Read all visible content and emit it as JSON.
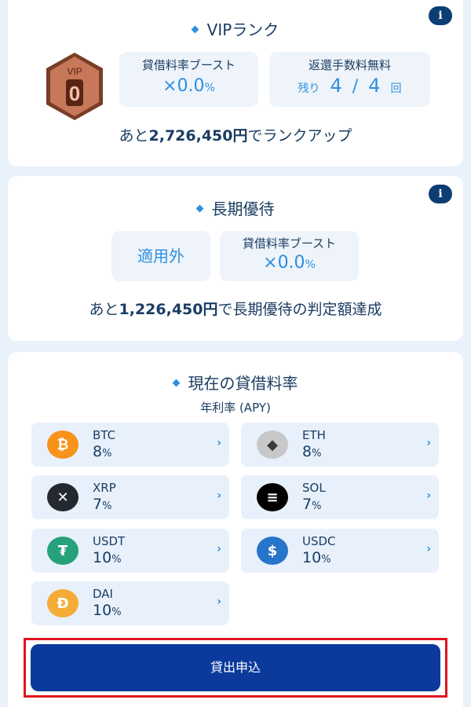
{
  "vip": {
    "title": "VIPランク",
    "badge_label": "VIP",
    "badge_level": "0",
    "boost_label": "貸借料率ブースト",
    "boost_prefix": "×",
    "boost_value": "0.0",
    "boost_unit": "%",
    "fee_label": "返還手数料無料",
    "fee_remaining_prefix": "残り",
    "fee_remaining": "4",
    "fee_separator": "/",
    "fee_total": "4",
    "fee_unit": "回",
    "rankup_prefix": "あと",
    "rankup_amount": "2,726,450円",
    "rankup_suffix": "でランクアップ"
  },
  "long_term": {
    "title": "長期優待",
    "status": "適用外",
    "boost_label": "貸借料率ブースト",
    "boost_prefix": "×",
    "boost_value": "0.0",
    "boost_unit": "%",
    "summary_prefix": "あと",
    "summary_amount": "1,226,450円",
    "summary_suffix": "で長期優待の判定額達成"
  },
  "rates": {
    "title": "現在の貸借料率",
    "subtitle": "年利率 (APY)",
    "coins": [
      {
        "name": "BTC",
        "rate": "8",
        "unit": "%",
        "icon": "btc-icon",
        "color": "#f7931a",
        "glyph": "₿"
      },
      {
        "name": "ETH",
        "rate": "8",
        "unit": "%",
        "icon": "eth-icon",
        "color": "#c8c8c8",
        "glyph": "◆"
      },
      {
        "name": "XRP",
        "rate": "7",
        "unit": "%",
        "icon": "xrp-icon",
        "color": "#23292f",
        "glyph": "✕"
      },
      {
        "name": "SOL",
        "rate": "7",
        "unit": "%",
        "icon": "sol-icon",
        "color": "#000000",
        "glyph": "≡"
      },
      {
        "name": "USDT",
        "rate": "10",
        "unit": "%",
        "icon": "usdt-icon",
        "color": "#26a17b",
        "glyph": "₮"
      },
      {
        "name": "USDC",
        "rate": "10",
        "unit": "%",
        "icon": "usdc-icon",
        "color": "#2775ca",
        "glyph": "$"
      },
      {
        "name": "DAI",
        "rate": "10",
        "unit": "%",
        "icon": "dai-icon",
        "color": "#f5ac37",
        "glyph": "Đ"
      }
    ]
  },
  "info_icon": "i",
  "chevron": "›",
  "apply_button": "貸出申込"
}
